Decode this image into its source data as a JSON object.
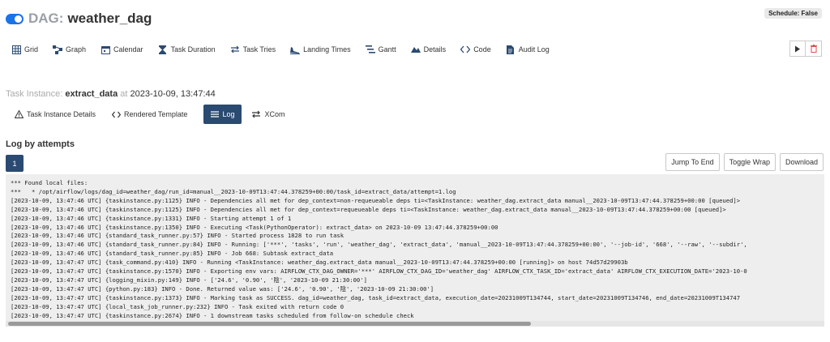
{
  "header": {
    "prefix": "DAG:",
    "dag_name": "weather_dag",
    "schedule": "Schedule: False"
  },
  "nav": [
    {
      "label": "Grid",
      "icon": "grid-icon"
    },
    {
      "label": "Graph",
      "icon": "graph-icon"
    },
    {
      "label": "Calendar",
      "icon": "calendar-icon"
    },
    {
      "label": "Task Duration",
      "icon": "hourglass-icon"
    },
    {
      "label": "Task Tries",
      "icon": "retry-icon"
    },
    {
      "label": "Landing Times",
      "icon": "plane-icon"
    },
    {
      "label": "Gantt",
      "icon": "gantt-icon"
    },
    {
      "label": "Details",
      "icon": "details-icon"
    },
    {
      "label": "Code",
      "icon": "code-icon"
    },
    {
      "label": "Audit Log",
      "icon": "file-icon"
    }
  ],
  "task_instance": {
    "label": "Task Instance:",
    "task": "extract_data",
    "at": "at",
    "date": "2023-10-09, 13:47:44"
  },
  "subtabs": [
    {
      "label": "Task Instance Details",
      "icon": "warning-icon"
    },
    {
      "label": "Rendered Template",
      "icon": "code-icon"
    },
    {
      "label": "Log",
      "icon": "list-icon"
    },
    {
      "label": "XCom",
      "icon": "exchange-icon"
    }
  ],
  "log": {
    "title": "Log by attempts",
    "attempt": "1",
    "jump_to_end": "Jump To End",
    "toggle_wrap": "Toggle Wrap",
    "download": "Download",
    "content": "*** Found local files:\n***   * /opt/airflow/logs/dag_id=weather_dag/run_id=manual__2023-10-09T13:47:44.378259+00:00/task_id=extract_data/attempt=1.log\n[2023-10-09, 13:47:46 UTC] {taskinstance.py:1125} INFO - Dependencies all met for dep_context=non-requeueable deps ti=<TaskInstance: weather_dag.extract_data manual__2023-10-09T13:47:44.378259+00:00 [queued]>\n[2023-10-09, 13:47:46 UTC] {taskinstance.py:1125} INFO - Dependencies all met for dep_context=requeueable deps ti=<TaskInstance: weather_dag.extract_data manual__2023-10-09T13:47:44.378259+00:00 [queued]>\n[2023-10-09, 13:47:46 UTC] {taskinstance.py:1331} INFO - Starting attempt 1 of 1\n[2023-10-09, 13:47:46 UTC] {taskinstance.py:1350} INFO - Executing <Task(PythonOperator): extract_data> on 2023-10-09 13:47:44.378259+00:00\n[2023-10-09, 13:47:46 UTC] {standard_task_runner.py:57} INFO - Started process 1828 to run task\n[2023-10-09, 13:47:46 UTC] {standard_task_runner.py:84} INFO - Running: ['***', 'tasks', 'run', 'weather_dag', 'extract_data', 'manual__2023-10-09T13:47:44.378259+00:00', '--job-id', '668', '--raw', '--subdir',\n[2023-10-09, 13:47:46 UTC] {standard_task_runner.py:85} INFO - Job 668: Subtask extract_data\n[2023-10-09, 13:47:47 UTC] {task_command.py:410} INFO - Running <TaskInstance: weather_dag.extract_data manual__2023-10-09T13:47:44.378259+00:00 [running]> on host 74d57d29903b\n[2023-10-09, 13:47:47 UTC] {taskinstance.py:1570} INFO - Exporting env vars: AIRFLOW_CTX_DAG_OWNER='***' AIRFLOW_CTX_DAG_ID='weather_dag' AIRFLOW_CTX_TASK_ID='extract_data' AIRFLOW_CTX_EXECUTION_DATE='2023-10-0\n[2023-10-09, 13:47:47 UTC] {logging_mixin.py:149} INFO - ['24.6', '0.90', '陰', '2023-10-09 21:30:00']\n[2023-10-09, 13:47:47 UTC] {python.py:183} INFO - Done. Returned value was: ['24.6', '0.90', '陰', '2023-10-09 21:30:00']\n[2023-10-09, 13:47:47 UTC] {taskinstance.py:1373} INFO - Marking task as SUCCESS. dag_id=weather_dag, task_id=extract_data, execution_date=20231009T134744, start_date=20231009T134746, end_date=20231009T134747\n[2023-10-09, 13:47:47 UTC] {local_task_job_runner.py:232} INFO - Task exited with return code 0\n[2023-10-09, 13:47:47 UTC] {taskinstance.py:2674} INFO - 1 downstream tasks scheduled from follow-on schedule check"
  }
}
